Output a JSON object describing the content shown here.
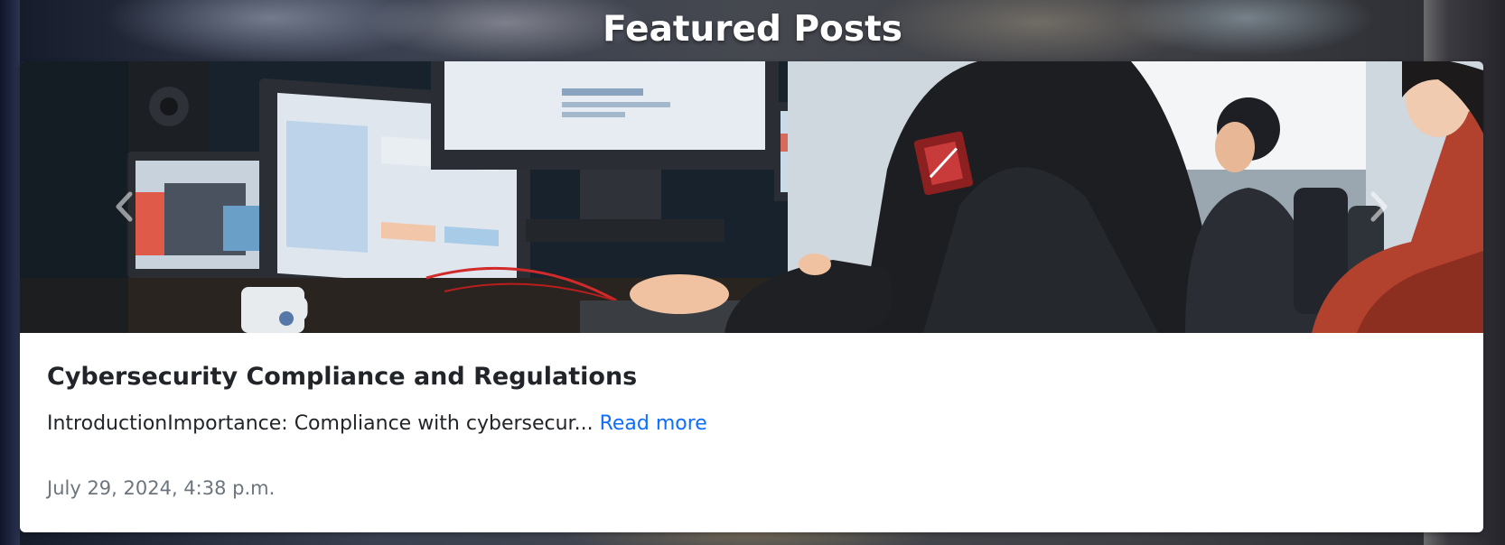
{
  "section": {
    "title": "Featured Posts"
  },
  "post": {
    "title": "Cybersecurity Compliance and Regulations",
    "excerpt": "IntroductionImportance: Compliance with cybersecur...",
    "read_more_label": "Read more",
    "date": "July 29, 2024, 4:38 p.m."
  },
  "carousel": {
    "prev_icon": "chevron-left-icon",
    "next_icon": "chevron-right-icon"
  },
  "colors": {
    "link": "#0d6efd",
    "muted_text": "#6c757d",
    "heading_text": "#212529",
    "title_white": "#ffffff"
  }
}
